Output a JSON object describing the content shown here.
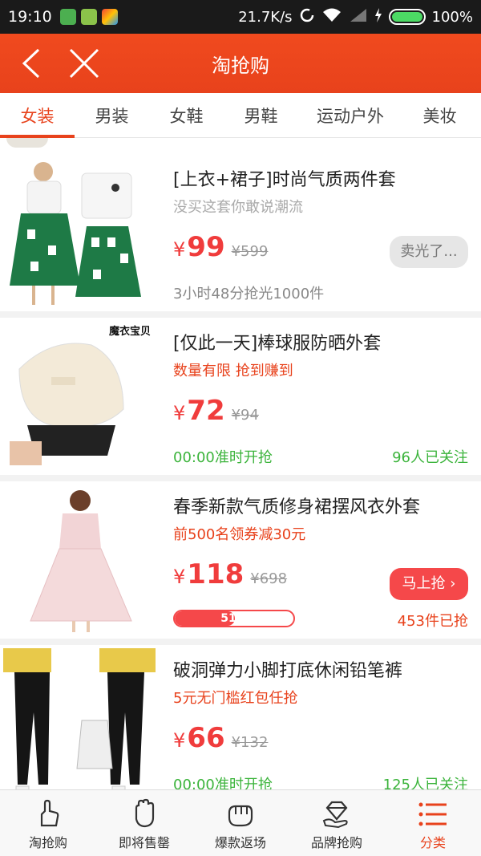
{
  "status_bar": {
    "time": "19:10",
    "network_speed": "21.7K/s",
    "battery": "100%",
    "battery_level": 1.0
  },
  "header": {
    "title": "淘抢购",
    "back_icon": "chevron-left-icon",
    "close_icon": "close-icon"
  },
  "tabs": [
    {
      "label": "女装",
      "active": true
    },
    {
      "label": "男装"
    },
    {
      "label": "女鞋"
    },
    {
      "label": "男鞋"
    },
    {
      "label": "运动户外"
    },
    {
      "label": "美妆"
    }
  ],
  "items": [
    {
      "title": "[上衣+裙子]时尚气质两件套",
      "subtitle": "没买这套你敢说潮流",
      "currency": "¥",
      "price": "99",
      "original_price": "¥599",
      "footer_left": "3小时48分抢光1000件",
      "button": "卖光了..."
    },
    {
      "title": "[仅此一天]棒球服防晒外套",
      "subtitle": "数量有限 抢到赚到",
      "currency": "¥",
      "price": "72",
      "original_price": "¥94",
      "footer_left": "00:00准时开抢",
      "footer_right": "96人已关注",
      "image_watermark": "魔衣宝贝"
    },
    {
      "title": "春季新款气质修身裙摆风衣外套",
      "subtitle": "前500名领券减30元",
      "currency": "¥",
      "price": "118",
      "original_price": "¥698",
      "progress_label": "51%",
      "progress_fraction": 0.51,
      "footer_right": "453件已抢",
      "button": "马上抢 ›"
    },
    {
      "title": "破洞弹力小脚打底休闲铅笔裤",
      "subtitle": "5元无门槛红包任抢",
      "currency": "¥",
      "price": "66",
      "original_price": "¥132",
      "footer_left": "00:00准时开抢",
      "footer_right": "125人已关注"
    }
  ],
  "bottom_nav": [
    {
      "label": "淘抢购",
      "icon": "hand-point-icon"
    },
    {
      "label": "即将售罄",
      "icon": "hand-wave-icon"
    },
    {
      "label": "爆款返场",
      "icon": "fist-icon"
    },
    {
      "label": "品牌抢购",
      "icon": "diamond-icon"
    },
    {
      "label": "分类",
      "icon": "list-icon",
      "active": true
    }
  ],
  "colors": {
    "accent": "#e8421c",
    "price": "#f03c3c",
    "green": "#3cb43c"
  }
}
